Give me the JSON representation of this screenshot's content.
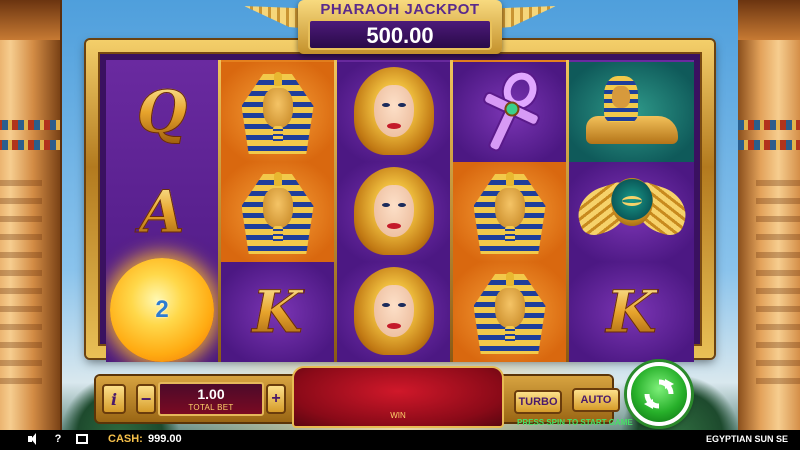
{
  "colors": {
    "reel_purple": "#4a1880",
    "reel_orange": "#d9680f",
    "gold": "#e8bb52",
    "spin_green": "#27b02a",
    "win_red": "#d0182a",
    "cash_label": "#f6c04a",
    "press_spin": "#46e066"
  },
  "jackpot": {
    "title": "PHARAOH JACKPOT",
    "value": "500.00"
  },
  "reels": [
    {
      "symbols": [
        "Q",
        "A",
        "sun"
      ],
      "icons": [
        "letter-q-icon",
        "letter-a-icon",
        "sun-icon"
      ]
    },
    {
      "symbols": [
        "pharaoh",
        "pharaoh",
        "K"
      ],
      "icons": [
        "pharaoh-icon",
        "pharaoh-icon",
        "letter-k-icon"
      ]
    },
    {
      "symbols": [
        "cleopatra",
        "cleopatra",
        "cleopatra"
      ],
      "icons": [
        "cleopatra-icon",
        "cleopatra-icon",
        "cleopatra-icon"
      ]
    },
    {
      "symbols": [
        "ankh",
        "pharaoh",
        "pharaoh"
      ],
      "icons": [
        "ankh-icon",
        "pharaoh-icon",
        "pharaoh-icon"
      ]
    },
    {
      "symbols": [
        "sphinx",
        "scarab",
        "K"
      ],
      "icons": [
        "sphinx-icon",
        "scarab-icon",
        "letter-k-icon"
      ]
    }
  ],
  "letters": {
    "q": "Q",
    "a": "A",
    "k": "K"
  },
  "sun": {
    "value": "2"
  },
  "controls": {
    "info_label": "i",
    "minus_label": "−",
    "plus_label": "+",
    "bet_value": "1.00",
    "bet_label": "TOTAL BET",
    "win_label": "WIN",
    "turbo_label": "TURBO",
    "auto_label": "AUTO",
    "press_spin": "PRESS SPIN TO START GAME"
  },
  "statusbar": {
    "cash_label": "CASH:",
    "cash_value": "999.00",
    "game_title": "EGYPTIAN SUN SE",
    "help_label": "?"
  }
}
